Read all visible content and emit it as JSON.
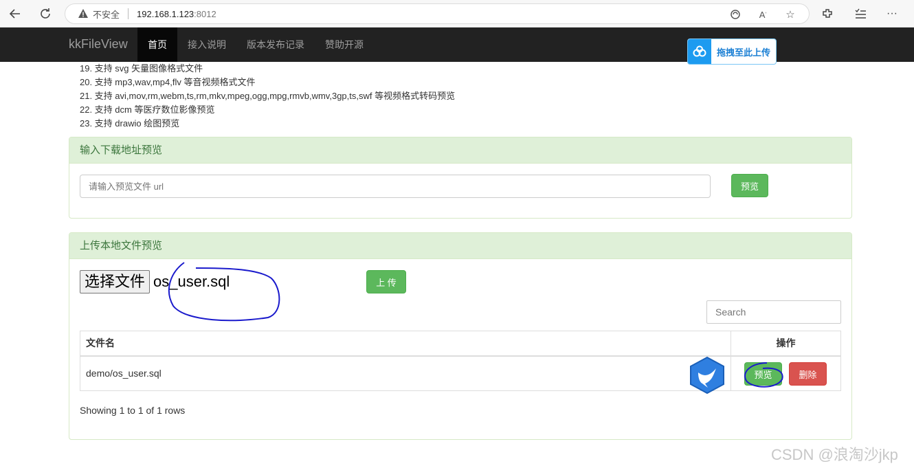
{
  "browser": {
    "insecure_label": "不安全",
    "url": "192.168.1.123",
    "port": ":8012"
  },
  "navbar": {
    "brand": "kkFileView",
    "items": [
      {
        "label": "首页",
        "active": true
      },
      {
        "label": "接入说明",
        "active": false
      },
      {
        "label": "版本发布记录",
        "active": false
      },
      {
        "label": "赞助开源",
        "active": false
      }
    ],
    "upload_float_label": "拖拽至此上传"
  },
  "features": [
    "19. 支持 svg 矢量图像格式文件",
    "20. 支持 mp3,wav,mp4,flv 等音视频格式文件",
    "21. 支持 avi,mov,rm,webm,ts,rm,mkv,mpeg,ogg,mpg,rmvb,wmv,3gp,ts,swf 等视频格式转码预览",
    "22. 支持 dcm 等医疗数位影像预览",
    "23. 支持 drawio 绘图预览"
  ],
  "url_panel": {
    "title": "输入下载地址预览",
    "input_placeholder": "请输入预览文件 url",
    "preview_button": "预览"
  },
  "upload_panel": {
    "title": "上传本地文件预览",
    "choose_file_button": "选择文件",
    "chosen_file": "os_user.sql",
    "upload_button": "上 传",
    "search_placeholder": "Search",
    "table": {
      "columns": [
        "文件名",
        "操作"
      ],
      "rows": [
        {
          "filename": "demo/os_user.sql",
          "preview": "预览",
          "delete": "删除"
        }
      ]
    },
    "showing": "Showing 1 to 1 of 1 rows"
  },
  "watermark": "CSDN @浪淘沙jkp",
  "colors": {
    "navbar_bg": "#222222",
    "panel_head_bg": "#dff0d8",
    "btn_success": "#5cb85c",
    "btn_danger": "#d9534f",
    "annotation_ink": "#1a1acc"
  }
}
